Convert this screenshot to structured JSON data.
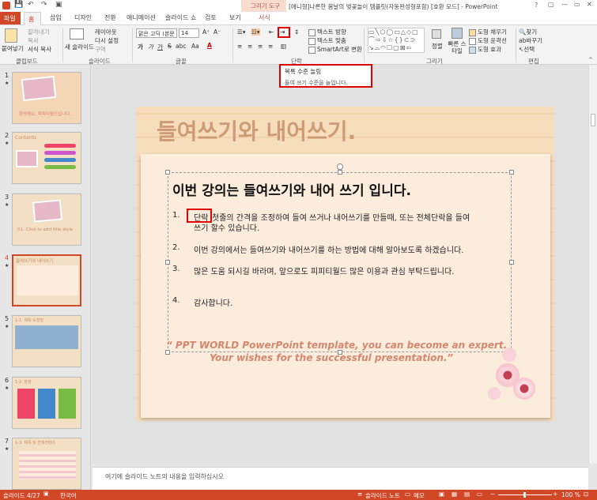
{
  "window": {
    "title": "[애니형]나른한 봄날의 벚꽃놀이 템플릿(자동완성형포함) [호환 모드] - PowerPoint",
    "context_tab": "그리기 도구",
    "controls": [
      "?",
      "▢",
      "—",
      "▭",
      "✕"
    ]
  },
  "tabs": [
    "파일",
    "홈",
    "삽입",
    "디자인",
    "전환",
    "애니메이션",
    "슬라이드 쇼",
    "검토",
    "보기",
    "서식"
  ],
  "active_tab": "홈",
  "ribbon": {
    "clipboard": {
      "paste": "붙여넣기",
      "cut": "잘라내기",
      "copy": "복사",
      "format_painter": "서식 복사",
      "label": "클립보드"
    },
    "slides": {
      "new_slide": "새 슬라이드",
      "layout": "레이아웃",
      "reset": "다시 설정",
      "section": "구역",
      "label": "슬라이드"
    },
    "font": {
      "font_name": "맑은 고딕 (본문",
      "font_size": "14",
      "bold": "가",
      "italic": "가",
      "underline": "가",
      "strike": "S",
      "spacing": "abc",
      "case": "Aa",
      "label": "글꼴"
    },
    "paragraph": {
      "text_direction": "텍스트 방향",
      "align_text": "텍스트 맞춤",
      "smartart": "SmartArt로 변환",
      "label": "단락"
    },
    "drawing": {
      "arrange": "정렬",
      "quick_styles": "빠른 스타일",
      "fill": "도형 채우기",
      "outline": "도형 윤곽선",
      "effects": "도형 효과",
      "label": "그리기"
    },
    "editing": {
      "find": "찾기",
      "replace": "바꾸기",
      "select": "선택",
      "label": "편집"
    }
  },
  "tooltip": {
    "title": "목록 수준 늘림",
    "desc": "들여 쓰기 수준을 늘입니다."
  },
  "thumbnails": [
    {
      "num": "1",
      "star": "★",
      "text": "환영해요, 피피티월드입니다."
    },
    {
      "num": "2",
      "star": "★",
      "text": "Contents"
    },
    {
      "num": "3",
      "star": "★",
      "text": "01. Click to add title style"
    },
    {
      "num": "4",
      "star": "★",
      "text": "들여쓰기와 내어쓰기"
    },
    {
      "num": "5",
      "star": "★",
      "text": "1-1. 제목 도형형"
    },
    {
      "num": "6",
      "star": "★",
      "text": "1-2. 장점"
    },
    {
      "num": "7",
      "star": "★",
      "text": "1-3. 제목 및 연계컨텐츠"
    }
  ],
  "slide": {
    "title": "들여쓰기와 내어쓰기.",
    "heading": "이번 강의는 들여쓰기와 내어 쓰기 입니다.",
    "items": [
      {
        "num": "1.",
        "highlight": "단락",
        "text": "첫줄의 간격을 조정하여 들여 쓰거나 내어쓰기를 만들때, 또는 전체단락을 들여",
        "text2": "쓰기 할수 있습니다."
      },
      {
        "num": "2.",
        "text": "이번 강의에서는 들여쓰기와 내어쓰기를 하는 방법에 대해 알아보도록 하겠습니다."
      },
      {
        "num": "3.",
        "text": "많은 도움 되시길 바라며, 앞으로도 피피티월드 많은 이용과 관심 부탁드립니다."
      },
      {
        "num": "4.",
        "text": "감사합니다."
      }
    ],
    "quote1": "“ PPT WORLD PowerPoint template, you can become an expert.",
    "quote2": "Your wishes for the successful presentation.”"
  },
  "notes_placeholder": "여기에 슬라이드 노트의 내용을 입력하십시오",
  "status": {
    "slide": "슬라이드 4/27",
    "lang": "한국어",
    "notes": "슬라이드 노트",
    "comments": "메모",
    "zoom": "100 %"
  },
  "colors": {
    "accent": "#d24726",
    "highlight_box": "#e00000",
    "quote": "#d4866e",
    "title": "#c9906a"
  }
}
